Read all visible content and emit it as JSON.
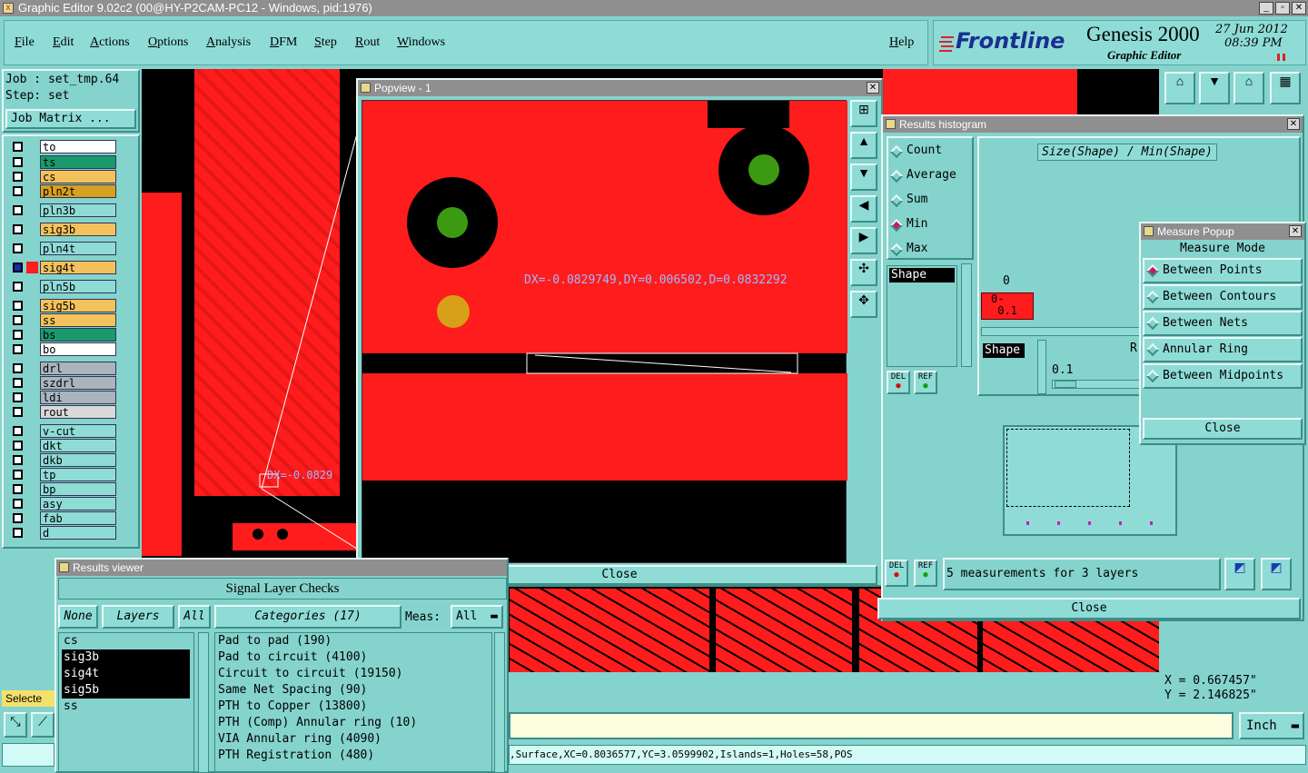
{
  "app": {
    "title": "Graphic Editor 9.02c2 (00@HY-P2CAM-PC12 - Windows, pid:1976)"
  },
  "menu": {
    "items": [
      "File",
      "Edit",
      "Actions",
      "Options",
      "Analysis",
      "DFM",
      "Step",
      "Rout",
      "Windows"
    ],
    "help": "Help"
  },
  "brand": {
    "logo": "Frontline",
    "product": "Genesis 2000",
    "subtitle": "Graphic Editor",
    "date": "27 Jun 2012",
    "time": "08:39 PM"
  },
  "job": {
    "job_label": "Job : set_tmp.64",
    "step_label": "Step: set",
    "matrix_button": "Job Matrix ..."
  },
  "layers": [
    {
      "name": "to",
      "color": "#ffffff"
    },
    {
      "name": "ts",
      "color": "#1a9a6c"
    },
    {
      "name": "cs",
      "color": "#f4c25a"
    },
    {
      "name": "pln2t",
      "color": "#d8a020"
    },
    {
      "name": "pln3b",
      "color": "#8fdcd6"
    },
    {
      "name": "sig3b",
      "color": "#f4c25a"
    },
    {
      "name": "pln4t",
      "color": "#8fdcd6"
    },
    {
      "name": "sig4t",
      "color": "#f4c25a"
    },
    {
      "name": "pln5b",
      "color": "#8fdcd6"
    },
    {
      "name": "sig5b",
      "color": "#f4c25a"
    },
    {
      "name": "ss",
      "color": "#f4c25a"
    },
    {
      "name": "bs",
      "color": "#1a9a6c"
    },
    {
      "name": "bo",
      "color": "#ffffff"
    },
    {
      "name": "drl",
      "color": "#a9b4bc"
    },
    {
      "name": "szdrl",
      "color": "#a9b4bc"
    },
    {
      "name": "ldi",
      "color": "#a9b4bc"
    },
    {
      "name": "rout",
      "color": "#d9d9d9"
    },
    {
      "name": "v-cut",
      "color": "#8fdcd6"
    },
    {
      "name": "dkt",
      "color": "#8fdcd6"
    },
    {
      "name": "dkb",
      "color": "#8fdcd6"
    },
    {
      "name": "tp",
      "color": "#8fdcd6"
    },
    {
      "name": "bp",
      "color": "#8fdcd6"
    },
    {
      "name": "asy",
      "color": "#8fdcd6"
    },
    {
      "name": "fab",
      "color": "#8fdcd6"
    },
    {
      "name": "d",
      "color": "#8fdcd6"
    }
  ],
  "left_bottom": {
    "selected_label": "Selecte"
  },
  "canvas": {
    "partial_measure": "DX=-0.0829"
  },
  "popview": {
    "title": "Popview - 1",
    "measurement": "DX=-0.0829749,DY=0.006502,D=0.0832292",
    "close": "Close"
  },
  "histogram": {
    "title": "Results histogram",
    "options": [
      "Count",
      "Average",
      "Sum",
      "Min",
      "Max"
    ],
    "selected": "Min",
    "shape_label": "Shape",
    "heading": "Size(Shape) / Min(Shape)",
    "axis_zero": "0",
    "bin_label": "0-\n 0.1",
    "shape_label2": "Shape",
    "r_label": "R",
    "value": "0.1",
    "del": "DEL",
    "ref": "REF",
    "status": "5 measurements for 3 layers",
    "close": "Close"
  },
  "measure": {
    "title": "Measure Popup",
    "heading": "Measure Mode",
    "modes": [
      "Between Points",
      "Between Contours",
      "Between Nets",
      "Annular Ring",
      "Between Midpoints"
    ],
    "selected": "Between Points",
    "close": "Close"
  },
  "results": {
    "title": "Results viewer",
    "heading": "Signal Layer Checks",
    "btn_none": "None",
    "btn_layers": "Layers",
    "btn_all": "All",
    "categories_label": "Categories (17)",
    "meas_label": "Meas:",
    "meas_value": "All",
    "layers": [
      {
        "name": "cs",
        "sel": false
      },
      {
        "name": "sig3b",
        "sel": true
      },
      {
        "name": "sig4t",
        "sel": true
      },
      {
        "name": "sig5b",
        "sel": true
      },
      {
        "name": "ss",
        "sel": false
      }
    ],
    "categories": [
      "Pad to pad (190)",
      "Pad to circuit (4100)",
      "Circuit to circuit (19150)",
      "Same Net Spacing (90)",
      "PTH to Copper (13800)",
      "PTH (Comp) Annular ring (10)",
      "VIA Annular ring (4090)",
      "PTH Registration (480)"
    ]
  },
  "coords": {
    "x": "X = 0.667457\"",
    "y": "Y = 2.146825\""
  },
  "units": {
    "value": "Inch"
  },
  "statusbar": {
    "text": ",Surface,XC=0.8036577,YC=3.0599902,Islands=1,Holes=58,POS"
  },
  "colors": {
    "copper": "#ff1c1c",
    "panel": "#85d3cd",
    "button": "#8fdcd6",
    "titlebar": "#8f8f8f",
    "selected": "#000000"
  }
}
